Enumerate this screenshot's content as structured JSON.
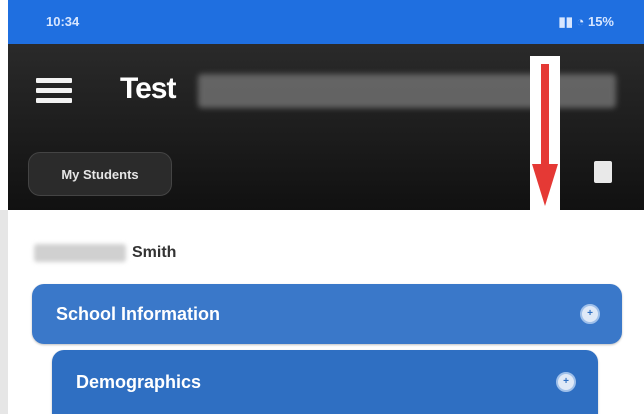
{
  "status_bar": {
    "time": "10:34",
    "battery": "15%"
  },
  "header": {
    "title": "Test",
    "students_button": "My Students"
  },
  "student": {
    "last_name": "Smith"
  },
  "accordions": [
    {
      "label": "School Information",
      "icon": "plus-circle-icon"
    },
    {
      "label": "Demographics",
      "icon": "plus-circle-icon"
    }
  ],
  "colors": {
    "status_bar": "#1f6fe0",
    "header": "#111111",
    "accordion": "#3a78c9",
    "annotation_arrow": "#e53935"
  }
}
